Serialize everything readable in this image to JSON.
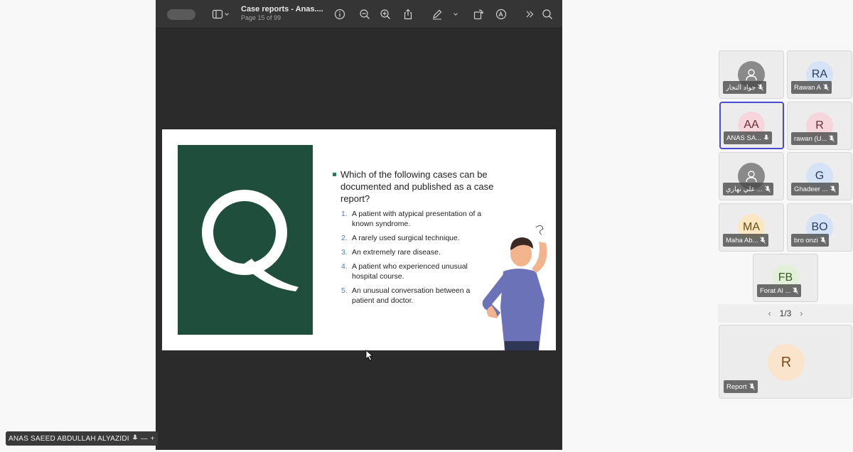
{
  "viewer": {
    "doc_title": "Case reports - Anas....",
    "page_info": "Page 15 of 99"
  },
  "slide": {
    "question": "Which of the following cases can be documented and published as a case report?",
    "options": [
      {
        "num": "1.",
        "text": "A patient with atypical presentation of a known syndrome."
      },
      {
        "num": "2.",
        "text": "A rarely used surgical technique."
      },
      {
        "num": "3.",
        "text": "An extremely rare disease."
      },
      {
        "num": "4.",
        "text": "A patient who experienced unusual hospital course."
      },
      {
        "num": "5.",
        "text": "An unusual conversation between a patient and doctor."
      }
    ],
    "colors": {
      "block": "#1f4e3d",
      "bullet": "#2f7a4e",
      "numbers": "#4d7fb8"
    }
  },
  "self_view": {
    "name": "ANAS SAEED ABDULLAH ALYAZIDI"
  },
  "participants": [
    {
      "initials": "",
      "name": "جواد النجار",
      "icon": "user-icon",
      "avatar_color": "#8a8a8a"
    },
    {
      "initials": "RA",
      "name": "Rawan A",
      "avatar_color": "#d6e2f5"
    },
    {
      "initials": "AA",
      "name": "ANAS SA...",
      "avatar_color": "#f6d6dc",
      "active": true
    },
    {
      "initials": "R",
      "name": "rawan (U...",
      "avatar_color": "#f6d6dc"
    },
    {
      "initials": "",
      "name": "علي نهاري ...",
      "icon": "user-icon",
      "avatar_color": "#8a8a8a"
    },
    {
      "initials": "G",
      "name": "Ghadeer ...",
      "avatar_color": "#d6e2f5"
    },
    {
      "initials": "MA",
      "name": "Maha Ab...",
      "avatar_color": "#fbe7c4"
    },
    {
      "initials": "BO",
      "name": "bro onzi",
      "avatar_color": "#d6e2f5"
    },
    {
      "initials": "FB",
      "name": "Forat Al ...",
      "avatar_color": "#e3f0d9"
    }
  ],
  "pager": {
    "label": "1/3"
  },
  "report": {
    "initials": "R",
    "name": "Report",
    "avatar_color": "#fbe4cc"
  }
}
